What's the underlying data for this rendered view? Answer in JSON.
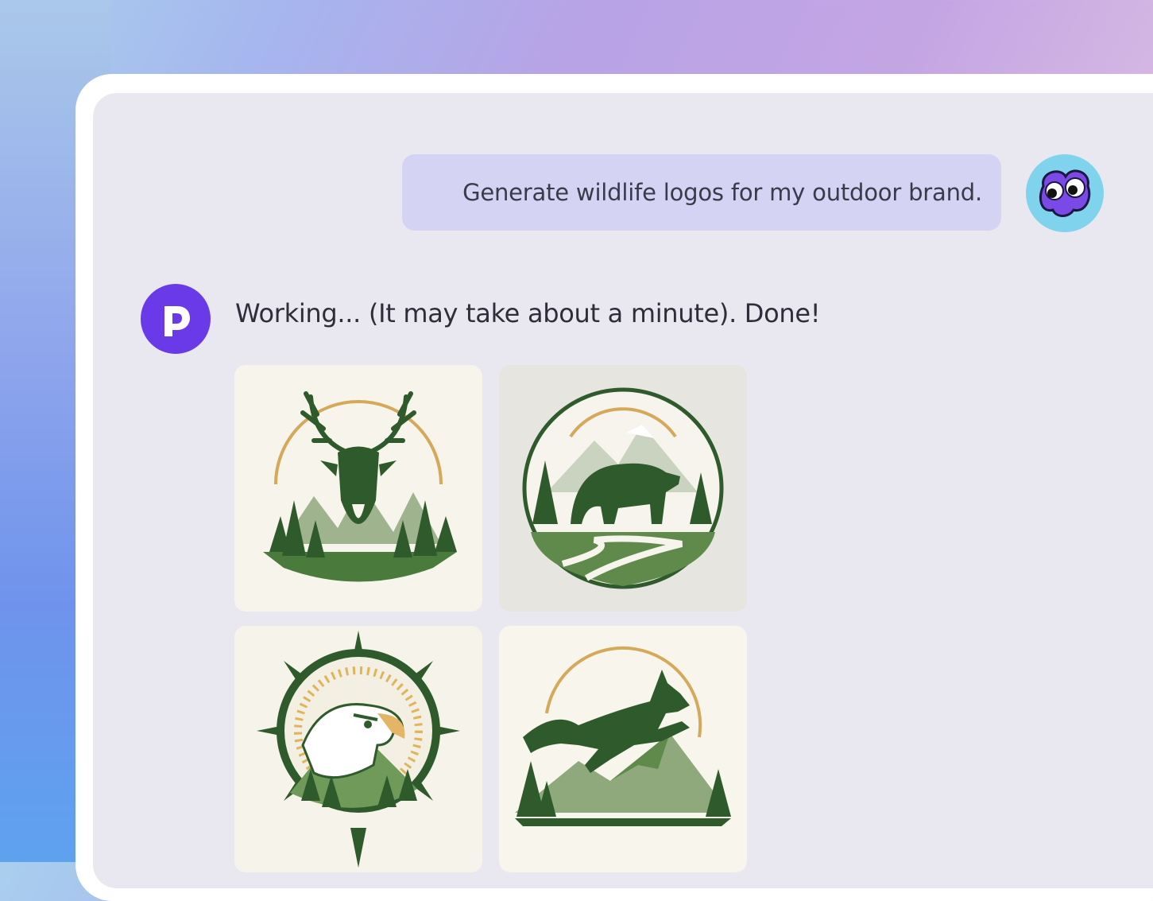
{
  "chat": {
    "user_message": "Generate wildlife logos for my outdoor brand.",
    "assistant_message": "Working... (It may take about a minute). Done!"
  },
  "images": [
    {
      "subject": "deer-logo"
    },
    {
      "subject": "bear-logo"
    },
    {
      "subject": "eagle-logo"
    },
    {
      "subject": "wolf-logo"
    }
  ],
  "colors": {
    "assistant_avatar": "#6a3ae8",
    "user_avatar": "#7fd3ec",
    "user_bubble": "#d5d3f3",
    "panel": "#e9e8f1",
    "logo_green": "#2f5a2c",
    "logo_gold": "#d6a85a"
  }
}
